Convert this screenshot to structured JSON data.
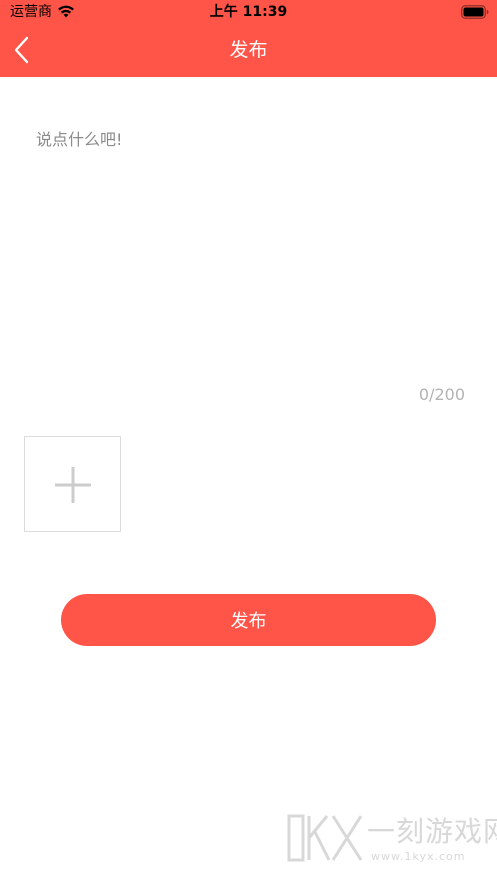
{
  "status_bar": {
    "carrier": "运营商",
    "time": "上午 11:39",
    "wifi_icon": "wifi-icon",
    "battery_icon": "battery-icon"
  },
  "nav": {
    "title": "发布",
    "back_icon": "chevron-left-icon"
  },
  "compose": {
    "placeholder": "说点什么吧!",
    "value": "",
    "counter": "0/200"
  },
  "attachments": {
    "add_icon": "plus-icon"
  },
  "actions": {
    "publish_label": "发布"
  },
  "watermark": {
    "logo_text": "1KYX",
    "text": "一刻游戏网",
    "url": "www.1kyx.com"
  },
  "colors": {
    "accent": "#ff5549",
    "placeholder": "#8a8a8a",
    "counter": "#b3b3b3",
    "border": "#dcdcdc",
    "watermark": "#d8d8d8"
  }
}
